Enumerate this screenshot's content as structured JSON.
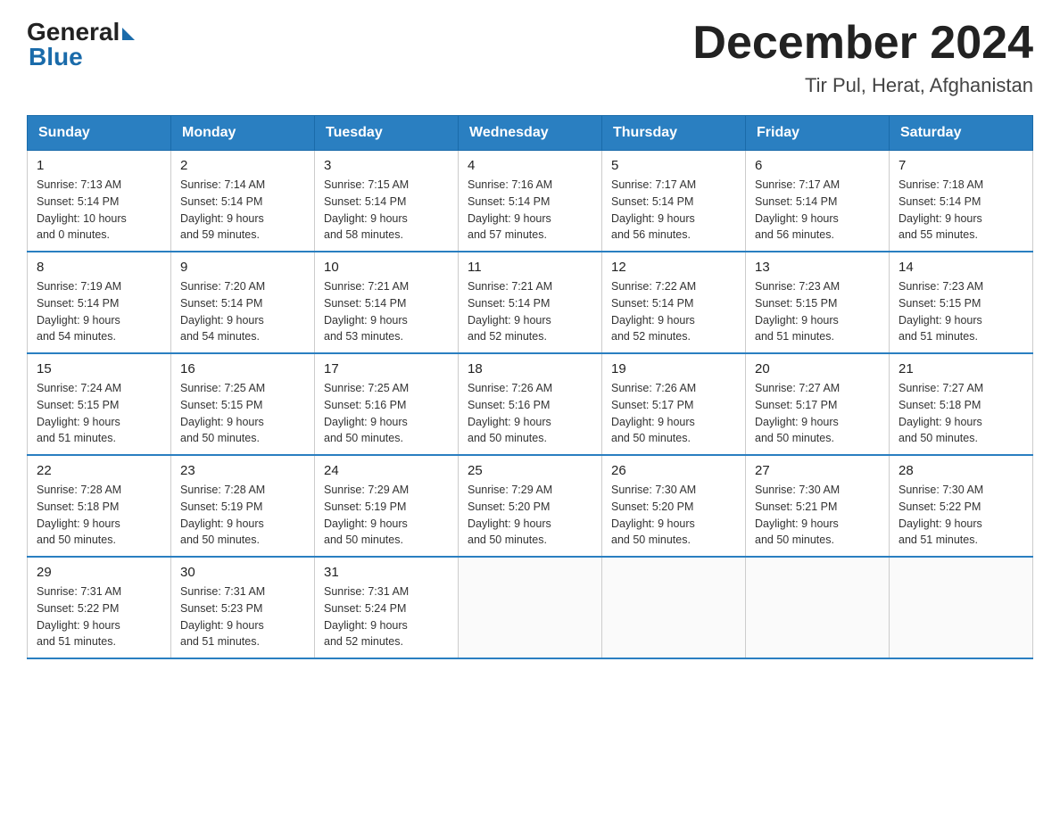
{
  "logo": {
    "general": "General",
    "blue": "Blue"
  },
  "title": "December 2024",
  "subtitle": "Tir Pul, Herat, Afghanistan",
  "headers": [
    "Sunday",
    "Monday",
    "Tuesday",
    "Wednesday",
    "Thursday",
    "Friday",
    "Saturday"
  ],
  "weeks": [
    [
      {
        "day": "1",
        "info": "Sunrise: 7:13 AM\nSunset: 5:14 PM\nDaylight: 10 hours\nand 0 minutes."
      },
      {
        "day": "2",
        "info": "Sunrise: 7:14 AM\nSunset: 5:14 PM\nDaylight: 9 hours\nand 59 minutes."
      },
      {
        "day": "3",
        "info": "Sunrise: 7:15 AM\nSunset: 5:14 PM\nDaylight: 9 hours\nand 58 minutes."
      },
      {
        "day": "4",
        "info": "Sunrise: 7:16 AM\nSunset: 5:14 PM\nDaylight: 9 hours\nand 57 minutes."
      },
      {
        "day": "5",
        "info": "Sunrise: 7:17 AM\nSunset: 5:14 PM\nDaylight: 9 hours\nand 56 minutes."
      },
      {
        "day": "6",
        "info": "Sunrise: 7:17 AM\nSunset: 5:14 PM\nDaylight: 9 hours\nand 56 minutes."
      },
      {
        "day": "7",
        "info": "Sunrise: 7:18 AM\nSunset: 5:14 PM\nDaylight: 9 hours\nand 55 minutes."
      }
    ],
    [
      {
        "day": "8",
        "info": "Sunrise: 7:19 AM\nSunset: 5:14 PM\nDaylight: 9 hours\nand 54 minutes."
      },
      {
        "day": "9",
        "info": "Sunrise: 7:20 AM\nSunset: 5:14 PM\nDaylight: 9 hours\nand 54 minutes."
      },
      {
        "day": "10",
        "info": "Sunrise: 7:21 AM\nSunset: 5:14 PM\nDaylight: 9 hours\nand 53 minutes."
      },
      {
        "day": "11",
        "info": "Sunrise: 7:21 AM\nSunset: 5:14 PM\nDaylight: 9 hours\nand 52 minutes."
      },
      {
        "day": "12",
        "info": "Sunrise: 7:22 AM\nSunset: 5:14 PM\nDaylight: 9 hours\nand 52 minutes."
      },
      {
        "day": "13",
        "info": "Sunrise: 7:23 AM\nSunset: 5:15 PM\nDaylight: 9 hours\nand 51 minutes."
      },
      {
        "day": "14",
        "info": "Sunrise: 7:23 AM\nSunset: 5:15 PM\nDaylight: 9 hours\nand 51 minutes."
      }
    ],
    [
      {
        "day": "15",
        "info": "Sunrise: 7:24 AM\nSunset: 5:15 PM\nDaylight: 9 hours\nand 51 minutes."
      },
      {
        "day": "16",
        "info": "Sunrise: 7:25 AM\nSunset: 5:15 PM\nDaylight: 9 hours\nand 50 minutes."
      },
      {
        "day": "17",
        "info": "Sunrise: 7:25 AM\nSunset: 5:16 PM\nDaylight: 9 hours\nand 50 minutes."
      },
      {
        "day": "18",
        "info": "Sunrise: 7:26 AM\nSunset: 5:16 PM\nDaylight: 9 hours\nand 50 minutes."
      },
      {
        "day": "19",
        "info": "Sunrise: 7:26 AM\nSunset: 5:17 PM\nDaylight: 9 hours\nand 50 minutes."
      },
      {
        "day": "20",
        "info": "Sunrise: 7:27 AM\nSunset: 5:17 PM\nDaylight: 9 hours\nand 50 minutes."
      },
      {
        "day": "21",
        "info": "Sunrise: 7:27 AM\nSunset: 5:18 PM\nDaylight: 9 hours\nand 50 minutes."
      }
    ],
    [
      {
        "day": "22",
        "info": "Sunrise: 7:28 AM\nSunset: 5:18 PM\nDaylight: 9 hours\nand 50 minutes."
      },
      {
        "day": "23",
        "info": "Sunrise: 7:28 AM\nSunset: 5:19 PM\nDaylight: 9 hours\nand 50 minutes."
      },
      {
        "day": "24",
        "info": "Sunrise: 7:29 AM\nSunset: 5:19 PM\nDaylight: 9 hours\nand 50 minutes."
      },
      {
        "day": "25",
        "info": "Sunrise: 7:29 AM\nSunset: 5:20 PM\nDaylight: 9 hours\nand 50 minutes."
      },
      {
        "day": "26",
        "info": "Sunrise: 7:30 AM\nSunset: 5:20 PM\nDaylight: 9 hours\nand 50 minutes."
      },
      {
        "day": "27",
        "info": "Sunrise: 7:30 AM\nSunset: 5:21 PM\nDaylight: 9 hours\nand 50 minutes."
      },
      {
        "day": "28",
        "info": "Sunrise: 7:30 AM\nSunset: 5:22 PM\nDaylight: 9 hours\nand 51 minutes."
      }
    ],
    [
      {
        "day": "29",
        "info": "Sunrise: 7:31 AM\nSunset: 5:22 PM\nDaylight: 9 hours\nand 51 minutes."
      },
      {
        "day": "30",
        "info": "Sunrise: 7:31 AM\nSunset: 5:23 PM\nDaylight: 9 hours\nand 51 minutes."
      },
      {
        "day": "31",
        "info": "Sunrise: 7:31 AM\nSunset: 5:24 PM\nDaylight: 9 hours\nand 52 minutes."
      },
      {
        "day": "",
        "info": ""
      },
      {
        "day": "",
        "info": ""
      },
      {
        "day": "",
        "info": ""
      },
      {
        "day": "",
        "info": ""
      }
    ]
  ]
}
